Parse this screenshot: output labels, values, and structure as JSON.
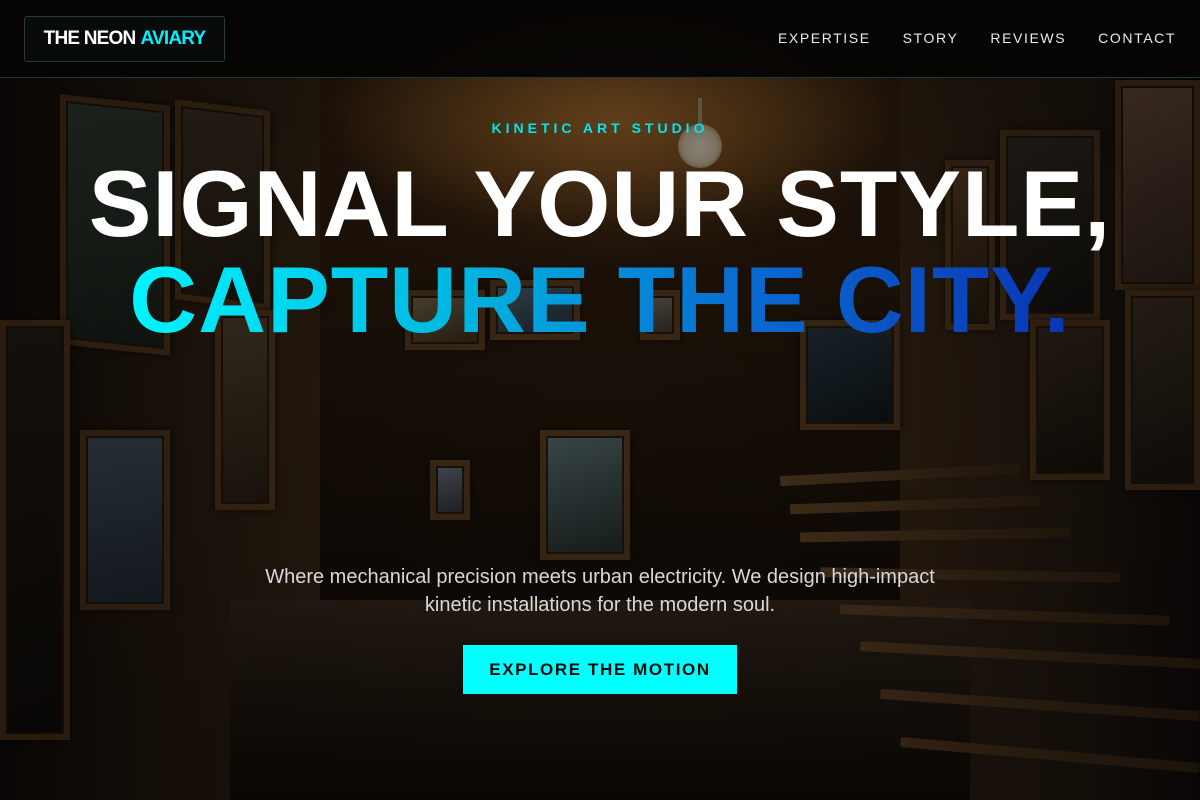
{
  "brand": {
    "name_part1": "THE NEON",
    "name_part2": "AVIARY"
  },
  "nav": {
    "items": [
      "EXPERTISE",
      "STORY",
      "REVIEWS",
      "CONTACT"
    ]
  },
  "hero": {
    "eyebrow": "KINETIC ART STUDIO",
    "headline_line1": "SIGNAL YOUR STYLE,",
    "headline_line2": "CAPTURE THE CITY.",
    "subtext": "Where mechanical precision meets urban electricity. We design high-impact kinetic installations for the modern soul.",
    "cta_label": "EXPLORE THE MOTION"
  },
  "colors": {
    "accent_cyan": "#00ffff",
    "gradient_start": "#00f5ff",
    "gradient_end": "#0a35b5",
    "header_bg": "#050403"
  }
}
